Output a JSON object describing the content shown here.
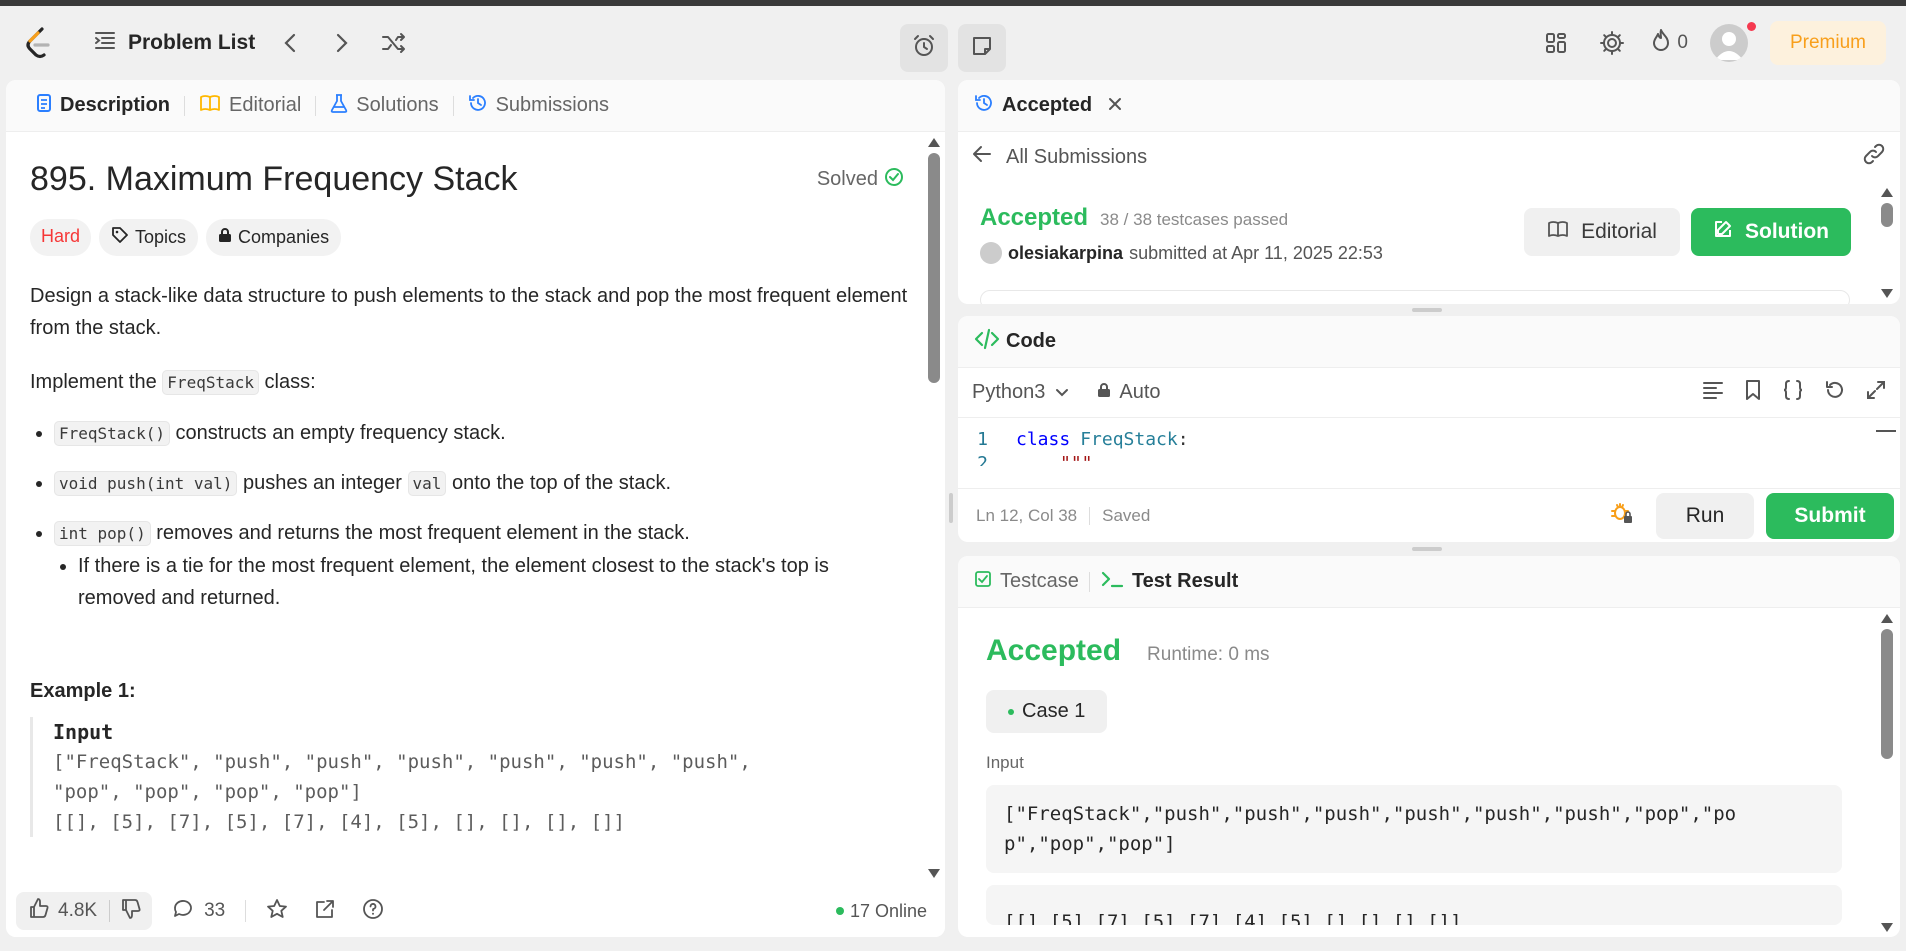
{
  "nav": {
    "title": "Problem List",
    "streak_count": "0",
    "premium_label": "Premium"
  },
  "left": {
    "tabs": [
      {
        "label": "Description"
      },
      {
        "label": "Editorial"
      },
      {
        "label": "Solutions"
      },
      {
        "label": "Submissions"
      }
    ],
    "problem_title": "895. Maximum Frequency Stack",
    "solved_label": "Solved",
    "tags": {
      "difficulty": "Hard",
      "topics": "Topics",
      "companies": "Companies"
    },
    "desc_p1": "Design a stack-like data structure to push elements to the stack and pop the most frequent element from the stack.",
    "desc_p2_prefix": "Implement the ",
    "desc_p2_code": "FreqStack",
    "desc_p2_suffix": " class:",
    "bullets": [
      {
        "code": "FreqStack()",
        "text": " constructs an empty frequency stack."
      },
      {
        "code": "void push(int val)",
        "text": " pushes an integer ",
        "code2": "val",
        "text2": " onto the top of the stack."
      },
      {
        "code": "int pop()",
        "text": " removes and returns the most frequent element in the stack."
      }
    ],
    "sub_bullet": "If there is a tie for the most frequent element, the element closest to the stack's top is removed and returned.",
    "example_title": "Example 1:",
    "example_input_label": "Input",
    "example_line1": "[\"FreqStack\", \"push\", \"push\", \"push\", \"push\", \"push\", \"push\",",
    "example_line2": "\"pop\", \"pop\", \"pop\", \"pop\"]",
    "example_line3": "[[], [5], [7], [5], [7], [4], [5], [], [], [], []]",
    "footer": {
      "likes": "4.8K",
      "comments": "33",
      "online": "17 Online"
    }
  },
  "submission": {
    "tab_label": "Accepted",
    "back_label": "All Submissions",
    "status": "Accepted",
    "testcases": "38 / 38 testcases passed",
    "user": "olesiakarpina",
    "submitted_at": "submitted at Apr 11, 2025 22:53",
    "editorial_btn": "Editorial",
    "solution_btn": "Solution"
  },
  "code": {
    "title": "Code",
    "language": "Python3",
    "mode": "Auto",
    "line1_num": "1",
    "line1_kw": "class",
    "line1_name": "FreqStack",
    "line1_colon": ":",
    "line2_num": "2",
    "line2_text": "\"\"\"",
    "cursor_pos": "Ln 12, Col 38",
    "saved": "Saved",
    "run_btn": "Run",
    "submit_btn": "Submit"
  },
  "result": {
    "tabs": [
      {
        "label": "Testcase"
      },
      {
        "label": "Test Result"
      }
    ],
    "status": "Accepted",
    "runtime": "Runtime: 0 ms",
    "case_label": "Case 1",
    "input_label": "Input",
    "input_line1": "[\"FreqStack\",\"push\",\"push\",\"push\",\"push\",\"push\",\"push\",\"pop\",\"po",
    "input_line2": "p\",\"pop\",\"pop\"]",
    "input2_line": "[[],[5],[7],[5],[7],[4],[5],[],[],[],[]]"
  },
  "colors": {
    "accent_green": "#2cbb5d",
    "hard_red": "#f63737",
    "premium_orange": "#f89f1b"
  }
}
